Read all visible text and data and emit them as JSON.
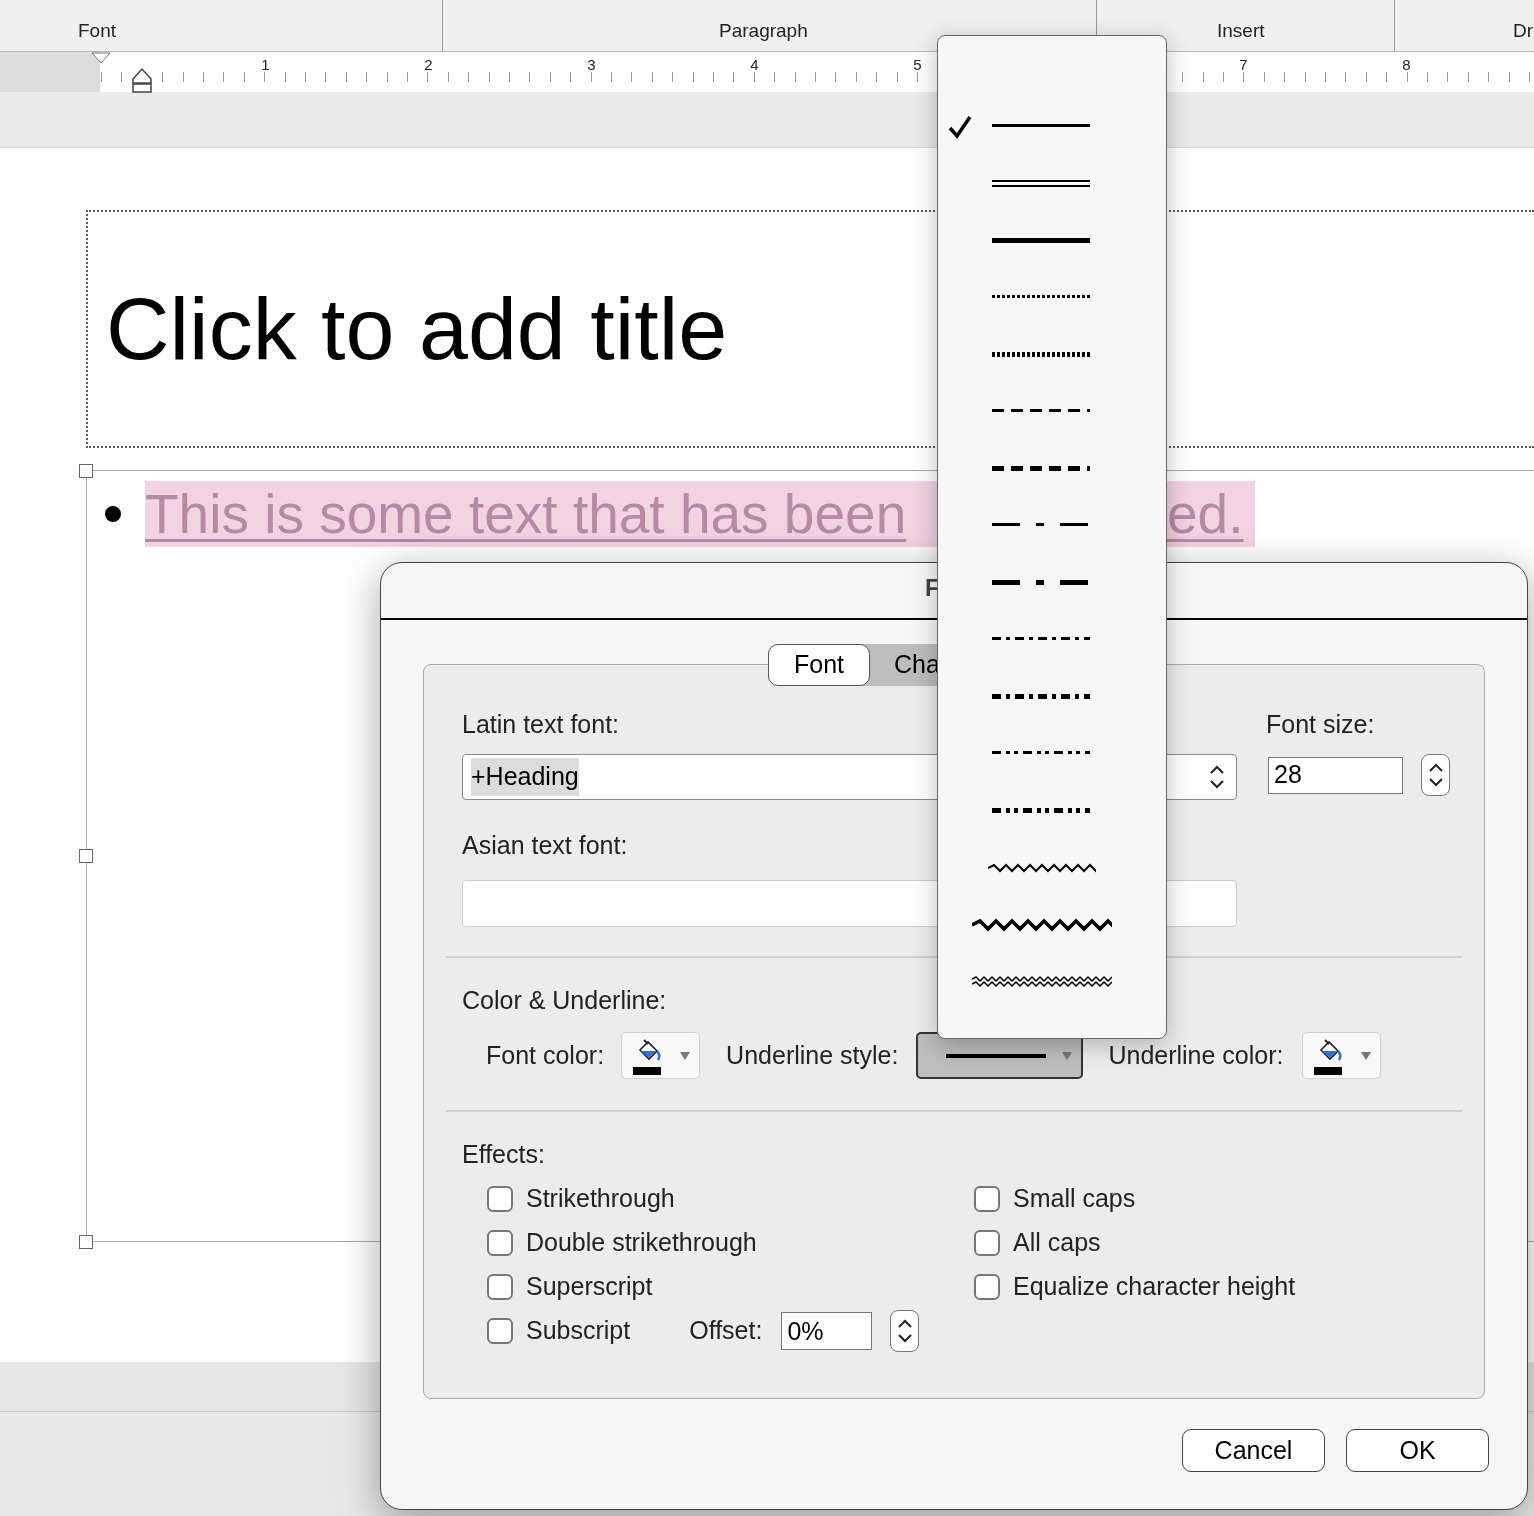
{
  "ribbon": {
    "groups": [
      "Font",
      "Paragraph",
      "Insert",
      "Dr"
    ]
  },
  "ruler": {
    "numbers": [
      "1",
      "2",
      "3",
      "4",
      "5",
      "7",
      "8"
    ]
  },
  "slide": {
    "title_placeholder": "Click to add title",
    "body_text_parts": [
      "This is some text that has been",
      "ed."
    ]
  },
  "dialog": {
    "title": "F",
    "tabs": [
      {
        "label": "Font",
        "selected": true
      },
      {
        "label": "Cha",
        "selected": false
      }
    ],
    "latin_font": {
      "label": "Latin text font:",
      "value": "+Heading"
    },
    "font_size": {
      "label": "Font size:",
      "value": "28"
    },
    "asian_font": {
      "label": "Asian text font:"
    },
    "color_underline": {
      "label": "Color & Underline:",
      "font_color": "Font color:",
      "underline_style": "Underline style:",
      "underline_color": "Underline color:"
    },
    "effects": {
      "label": "Effects:",
      "left": [
        {
          "label": "Strikethrough",
          "checked": false
        },
        {
          "label": "Double strikethrough",
          "checked": false
        },
        {
          "label": "Superscript",
          "checked": false
        },
        {
          "label": "Subscript",
          "checked": false
        }
      ],
      "right": [
        {
          "label": "Small caps",
          "checked": false
        },
        {
          "label": "All caps",
          "checked": false
        },
        {
          "label": "Equalize character height",
          "checked": false
        }
      ],
      "offset_label": "Offset:",
      "offset_value": "0%"
    },
    "buttons": [
      "Cancel",
      "OK"
    ]
  },
  "underline_menu": [
    {
      "kind": "single",
      "selected": true
    },
    {
      "kind": "double",
      "selected": false
    },
    {
      "kind": "thick",
      "selected": false
    },
    {
      "kind": "dotted",
      "selected": false
    },
    {
      "kind": "dotted-heavy",
      "selected": false
    },
    {
      "kind": "dash",
      "selected": false
    },
    {
      "kind": "dash-heavy",
      "selected": false
    },
    {
      "kind": "long-dash",
      "selected": false
    },
    {
      "kind": "long-dash-heavy",
      "selected": false
    },
    {
      "kind": "dot-dash",
      "selected": false
    },
    {
      "kind": "dot-dash-heavy",
      "selected": false
    },
    {
      "kind": "dot-dot-dash",
      "selected": false
    },
    {
      "kind": "dot-dot-dash-heavy",
      "selected": false
    },
    {
      "kind": "wavy",
      "selected": false
    },
    {
      "kind": "wavy-heavy",
      "selected": false
    },
    {
      "kind": "wavy-double",
      "selected": false
    }
  ]
}
